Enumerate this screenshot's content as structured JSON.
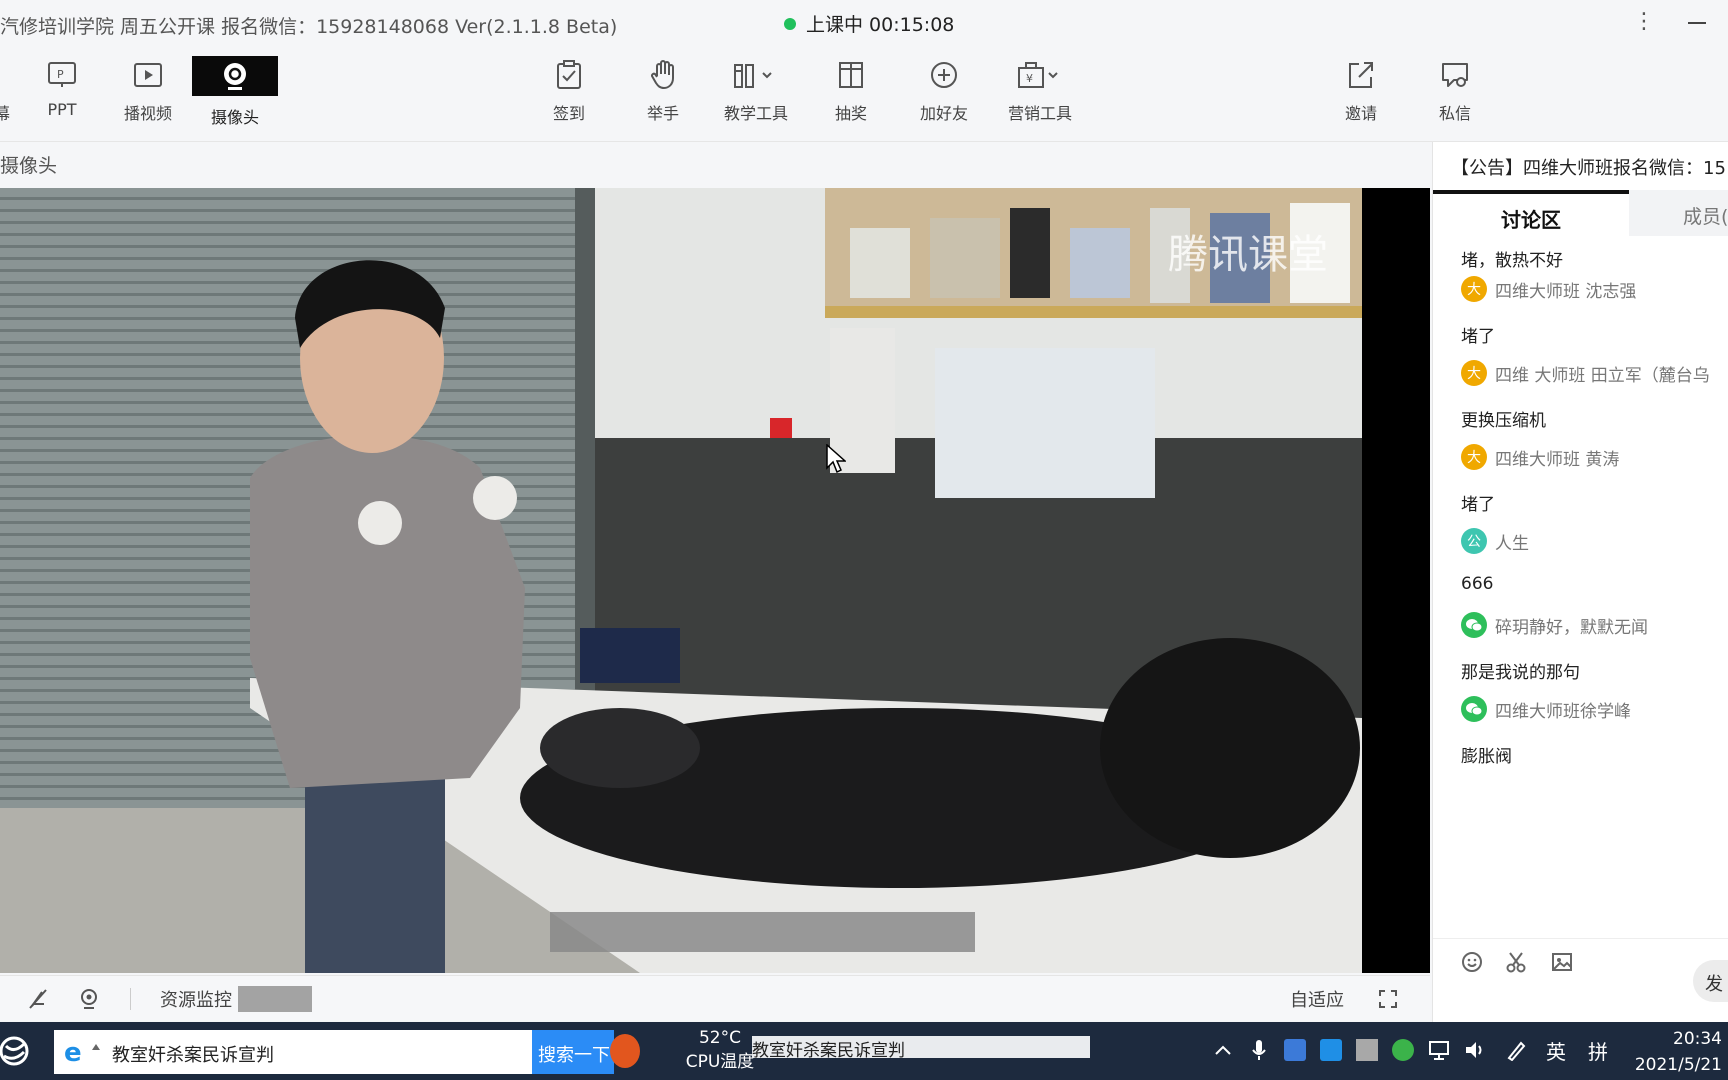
{
  "window": {
    "title": "汽修培训学院  周五公开课  报名微信：15928148068 Ver(2.1.1.8 Beta)",
    "status": "上课中 00:15:08"
  },
  "toolbar": {
    "left": [
      {
        "id": "screen",
        "label": "幕",
        "icon": "screen-share-icon"
      },
      {
        "id": "ppt",
        "label": "PPT",
        "icon": "ppt-icon"
      },
      {
        "id": "video",
        "label": "播视频",
        "icon": "play-video-icon"
      },
      {
        "id": "camera",
        "label": "摄像头",
        "icon": "camera-icon",
        "active": true
      }
    ],
    "center": [
      {
        "id": "checkin",
        "label": "签到",
        "icon": "clipboard-check-icon"
      },
      {
        "id": "raise",
        "label": "举手",
        "icon": "hand-icon"
      },
      {
        "id": "tools",
        "label": "教学工具",
        "icon": "toolbox-icon"
      },
      {
        "id": "lottery",
        "label": "抽奖",
        "icon": "gift-icon"
      },
      {
        "id": "friend",
        "label": "加好友",
        "icon": "plus-circle-icon"
      },
      {
        "id": "marketing",
        "label": "营销工具",
        "icon": "marketing-bag-icon"
      }
    ],
    "right": [
      {
        "id": "invite",
        "label": "邀请",
        "icon": "share-out-icon"
      },
      {
        "id": "pm",
        "label": "私信",
        "icon": "message-icon"
      }
    ]
  },
  "panel": {
    "label": "摄像头"
  },
  "video": {
    "watermark": "腾讯课堂"
  },
  "controls": {
    "resource_monitor": "资源监控",
    "fit": "自适应"
  },
  "sidebar": {
    "notice": "【公告】四维大师班报名微信：15",
    "tab_discussion": "讨论区",
    "tab_members": "成员(",
    "messages": [
      {
        "type": "text",
        "text": "堵，散热不好"
      },
      {
        "type": "user",
        "name": "四维大师班 沈志强",
        "badge": "大",
        "color": "#f0a800"
      },
      {
        "type": "text",
        "text": "堵了"
      },
      {
        "type": "user",
        "name": "四维 大师班 田立军（麓台乌",
        "badge": "大",
        "color": "#f0a800"
      },
      {
        "type": "text",
        "text": "更换压缩机"
      },
      {
        "type": "user",
        "name": "四维大师班 黄涛",
        "badge": "大",
        "color": "#f0a800"
      },
      {
        "type": "text",
        "text": "堵了"
      },
      {
        "type": "user",
        "name": "人生",
        "badge": "公",
        "color": "#3ec6b0"
      },
      {
        "type": "text",
        "text": "666"
      },
      {
        "type": "user",
        "name": "碎玥静好，默默无闻",
        "badge": "微",
        "color": "#2ebf5b"
      },
      {
        "type": "text",
        "text": "那是我说的那句"
      },
      {
        "type": "user",
        "name": "四维大师班徐学峰",
        "badge": "微",
        "color": "#2ebf5b"
      },
      {
        "type": "text",
        "text": "膨胀阀"
      }
    ],
    "send": "发"
  },
  "taskbar": {
    "search_text": "教室奸杀案民诉宣判",
    "search_button": "搜索一下",
    "temperature": "52°C",
    "temperature_label": "CPU温度",
    "news_text": "教室奸杀案民诉宣判",
    "lang1": "英",
    "lang2": "拼",
    "time": "20:34",
    "date": "2021/5/21"
  }
}
